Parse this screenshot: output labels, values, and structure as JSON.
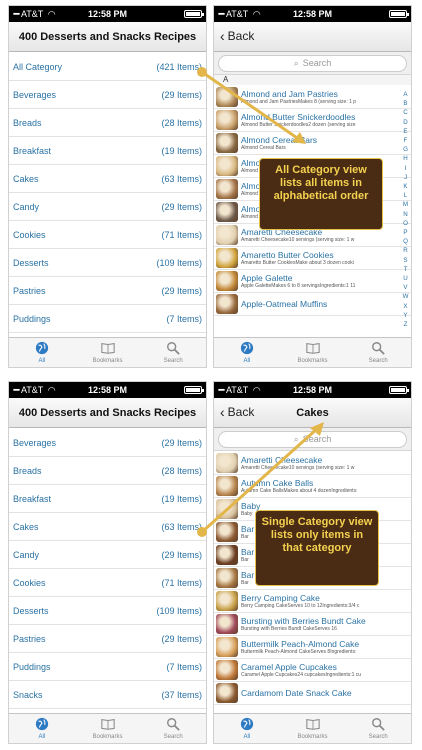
{
  "status": {
    "carrier": "AT&T",
    "time": "12:58 PM"
  },
  "categories_screen": {
    "title": "400 Desserts and Snacks Recipes",
    "items": [
      {
        "label": "All Category",
        "count": "(421 Items)"
      },
      {
        "label": "Beverages",
        "count": "(29 Items)"
      },
      {
        "label": "Breads",
        "count": "(28 Items)"
      },
      {
        "label": "Breakfast",
        "count": "(19 Items)"
      },
      {
        "label": "Cakes",
        "count": "(63 Items)"
      },
      {
        "label": "Candy",
        "count": "(29 Items)"
      },
      {
        "label": "Cookies",
        "count": "(71 Items)"
      },
      {
        "label": "Desserts",
        "count": "(109 Items)"
      },
      {
        "label": "Pastries",
        "count": "(29 Items)"
      },
      {
        "label": "Puddings",
        "count": "(7 Items)"
      }
    ]
  },
  "categories_screen_2": {
    "title": "400 Desserts and Snacks Recipes",
    "items": [
      {
        "label": "Beverages",
        "count": "(29 Items)"
      },
      {
        "label": "Breads",
        "count": "(28 Items)"
      },
      {
        "label": "Breakfast",
        "count": "(19 Items)"
      },
      {
        "label": "Cakes",
        "count": "(63 Items)"
      },
      {
        "label": "Candy",
        "count": "(29 Items)"
      },
      {
        "label": "Cookies",
        "count": "(71 Items)"
      },
      {
        "label": "Desserts",
        "count": "(109 Items)"
      },
      {
        "label": "Pastries",
        "count": "(29 Items)"
      },
      {
        "label": "Puddings",
        "count": "(7 Items)"
      },
      {
        "label": "Snacks",
        "count": "(37 Items)"
      }
    ]
  },
  "all_screen": {
    "back": "Back",
    "title": "",
    "search_placeholder": "Search",
    "section": "A",
    "recipes": [
      {
        "name": "Almond and Jam Pastries",
        "desc": "Almond and Jam PastriesMakes 8 (serving size: 1 p",
        "color": "#b08a5a"
      },
      {
        "name": "Almond Butter Snickerdoodles",
        "desc": "Almond Butter Snickerdoodles2 dozen (serving size",
        "color": "#c9a06a"
      },
      {
        "name": "Almond Cereal Bars",
        "desc": "Almond Cereal Bars",
        "color": "#8a6a44"
      },
      {
        "name": "Almond Cookies",
        "desc": "Almond Cookies",
        "color": "#d8b880"
      },
      {
        "name": "Almond Cookies",
        "desc": "Almond Cookies",
        "color": "#a5764a"
      },
      {
        "name": "Almond Pastries",
        "desc": "Almond Pastries",
        "color": "#6e5a4a"
      },
      {
        "name": "Amaretti Cheesecake",
        "desc": "Amaretti Cheesecake10 servings (serving size: 1 w",
        "color": "#e1d0b0"
      },
      {
        "name": "Amaretto Butter Cookies",
        "desc": "Amaretto Butter CookiesMake about 3 dozen cooki",
        "color": "#d2a640"
      },
      {
        "name": "Apple Galette",
        "desc": "Apple GaletteMakes 6 to 8 servingsIngredients:1 11",
        "color": "#c48a3a"
      },
      {
        "name": "Apple-Oatmeal Muffins",
        "desc": "",
        "color": "#9a6b3e"
      }
    ],
    "index": [
      "A",
      "B",
      "C",
      "D",
      "E",
      "F",
      "G",
      "H",
      "I",
      "J",
      "K",
      "L",
      "M",
      "N",
      "O",
      "P",
      "Q",
      "R",
      "S",
      "T",
      "U",
      "V",
      "W",
      "X",
      "Y",
      "Z"
    ]
  },
  "cakes_screen": {
    "back": "Back",
    "title": "Cakes",
    "search_placeholder": "Search",
    "recipes": [
      {
        "name": "Amaretti Cheesecake",
        "desc": "Amaretti Cheesecake10 servings (serving size: 1 w",
        "color": "#e1d0b0"
      },
      {
        "name": "Autumn Cake Balls",
        "desc": "Autumn Cake BallsMakes about 4 dozenIngredients:",
        "color": "#b8864e"
      },
      {
        "name": "Baby",
        "desc": "Baby",
        "color": "#d9c3a0"
      },
      {
        "name": "Bar",
        "desc": "Bar",
        "color": "#8c5a34"
      },
      {
        "name": "Bar",
        "desc": "Bar",
        "color": "#6b3e22"
      },
      {
        "name": "Bar",
        "desc": "Bar",
        "color": "#a67844"
      },
      {
        "name": "Berry Camping Cake",
        "desc": "Berry Camping CakeServes 10 to 12Ingredients:3/4 c",
        "color": "#c9a24a"
      },
      {
        "name": "Bursting with Berries Bundt Cake",
        "desc": "Bursting with Berries Bundt CakeServes 16",
        "color": "#a04a5a"
      },
      {
        "name": "Buttermilk Peach-Almond Cake",
        "desc": "Buttermilk Peach-Almond CakeServes 8Ingredients:",
        "color": "#d8a05a"
      },
      {
        "name": "Caramel Apple Cupcakes",
        "desc": "Caramel Apple Cupcakes24 cupcakesIngredients:1 cu",
        "color": "#c07a3a"
      },
      {
        "name": "Cardamom Date Snack Cake",
        "desc": "",
        "color": "#8a5a30"
      }
    ]
  },
  "tabs": [
    {
      "label": "All",
      "icon": "globe-icon"
    },
    {
      "label": "Bookmarks",
      "icon": "book-icon"
    },
    {
      "label": "Search",
      "icon": "magnifier-icon"
    }
  ],
  "callouts": {
    "all": "All Category view lists all items in alphabetical order",
    "single": "Single Category view lists only items in that category"
  },
  "colors": {
    "link": "#2a72a4",
    "callout_bg": "#4a2b14",
    "callout_text": "#f5d24f",
    "arrow": "#e3b64a",
    "tab_active": "#2e7bc4"
  }
}
